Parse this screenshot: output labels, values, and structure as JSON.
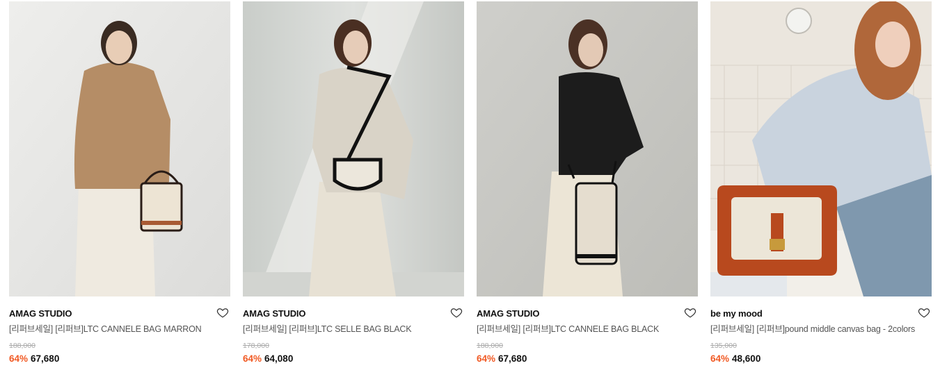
{
  "products": [
    {
      "brand": "AMAG STUDIO",
      "title": "[리퍼브세일] [리퍼브]LTC CANNELE BAG MARRON",
      "original_price": "188,000",
      "discount": "64%",
      "sale_price": "67,680",
      "wishlist_icon": "heart-outline-icon"
    },
    {
      "brand": "AMAG STUDIO",
      "title": "[리퍼브세일] [리퍼브]LTC SELLE BAG BLACK",
      "original_price": "178,000",
      "discount": "64%",
      "sale_price": "64,080",
      "wishlist_icon": "heart-outline-icon"
    },
    {
      "brand": "AMAG STUDIO",
      "title": "[리퍼브세일] [리퍼브]LTC CANNELE BAG BLACK",
      "original_price": "188,000",
      "discount": "64%",
      "sale_price": "67,680",
      "wishlist_icon": "heart-outline-icon"
    },
    {
      "brand": "be my mood",
      "title": "[리퍼브세일] [리퍼브]pound middle canvas bag - 2colors",
      "original_price": "135,000",
      "discount": "64%",
      "sale_price": "48,600",
      "wishlist_icon": "heart-outline-icon"
    }
  ],
  "colors": {
    "discount": "#f15a24",
    "price": "#111111",
    "original_price": "#aaaaaa"
  }
}
